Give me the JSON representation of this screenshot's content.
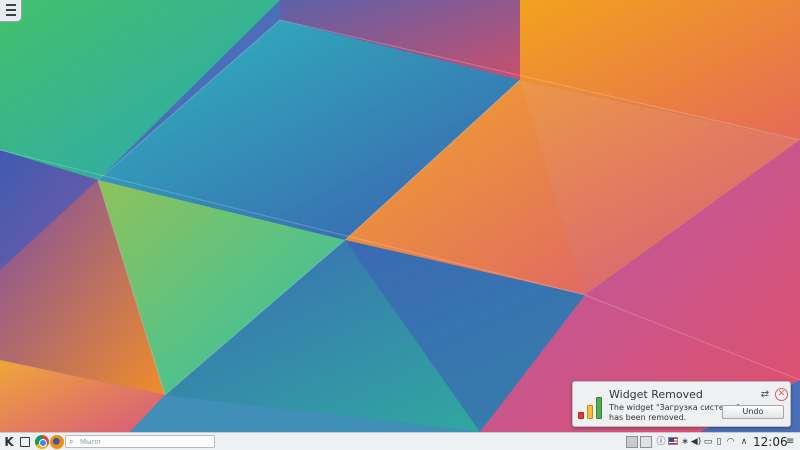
{
  "desktop": {
    "colors": {
      "teal": "#2fb3b8",
      "blue": "#3367b8",
      "green": "#4fbf58",
      "orange": "#f39a1e",
      "purple": "#7b5aa6",
      "pink": "#d5527a"
    }
  },
  "notification": {
    "title": "Widget Removed",
    "body_line1": "The widget \"Загрузка системы\"",
    "body_line2": "has been removed.",
    "undo_label": "Undo",
    "icon": "system-load-bars-icon"
  },
  "panel": {
    "launcher_icon": "kde-icon",
    "search": {
      "placeholder": "Мыпп"
    },
    "pinned_apps": [
      "file-manager-icon",
      "chrome-icon",
      "firefox-icon"
    ],
    "tray_icons": [
      "info-icon",
      "flag-icon",
      "bluetooth-icon",
      "volume-icon",
      "clipboard-icon",
      "battery-icon",
      "network-icon",
      "expand-arrow-icon"
    ],
    "clock": "12:06"
  }
}
